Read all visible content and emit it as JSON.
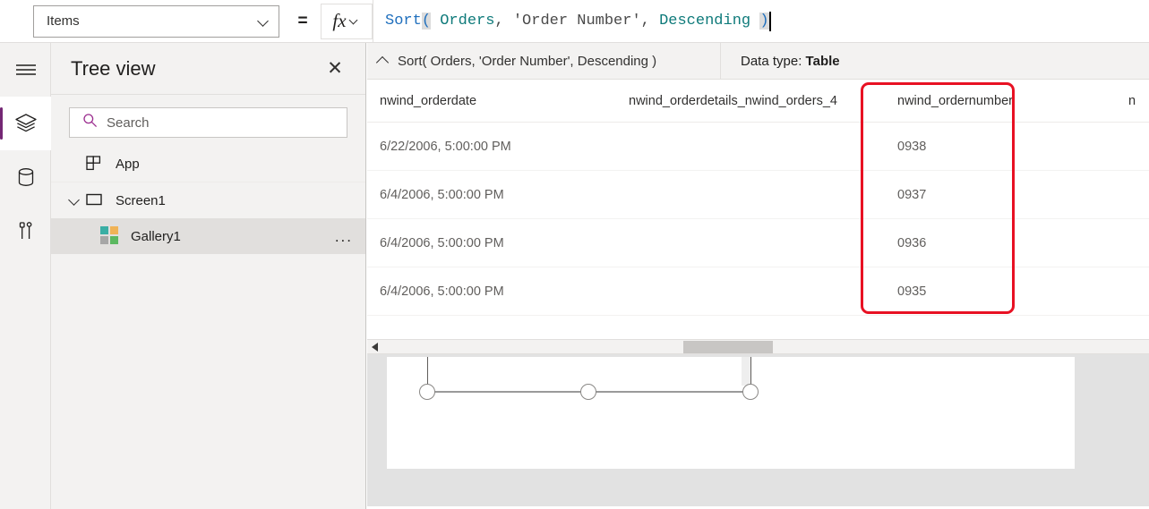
{
  "formula_bar": {
    "property_selector": {
      "value": "Items",
      "chevron_icon": "chevron-down-icon"
    },
    "equals_sign": "=",
    "fx_button": {
      "glyph": "fx",
      "icon": "function-icon",
      "chevron_icon": "chevron-down-icon"
    },
    "formula_tokens": [
      {
        "text": "Sort",
        "type": "function"
      },
      {
        "text": "(",
        "type": "paren"
      },
      {
        "text": " ",
        "type": "plain"
      },
      {
        "text": "Orders",
        "type": "identifier"
      },
      {
        "text": ", ",
        "type": "plain"
      },
      {
        "text": "'Order Number'",
        "type": "string"
      },
      {
        "text": ", ",
        "type": "plain"
      },
      {
        "text": "Descending",
        "type": "identifier"
      },
      {
        "text": " ",
        "type": "plain"
      },
      {
        "text": ")",
        "type": "paren"
      }
    ],
    "formula_text": "Sort( Orders, 'Order Number', Descending )"
  },
  "rail": {
    "items": [
      {
        "name": "hamburger-menu-icon",
        "label": "Menu",
        "active": false
      },
      {
        "name": "tree-view-layers-icon",
        "label": "Tree view",
        "active": true
      },
      {
        "name": "data-sources-icon",
        "label": "Data",
        "active": false
      },
      {
        "name": "insert-tools-icon",
        "label": "Insert",
        "active": false
      }
    ]
  },
  "tree_view": {
    "title": "Tree view",
    "close_icon": "close-icon",
    "search": {
      "placeholder": "Search",
      "value": "",
      "icon": "search-icon"
    },
    "items": [
      {
        "label": "App",
        "icon": "app-grid-icon",
        "level": 1,
        "selected": false,
        "expander": false,
        "overflow": false
      },
      {
        "label": "Screen1",
        "icon": "screen-rect-icon",
        "level": 1,
        "selected": false,
        "expander": true,
        "overflow": false
      },
      {
        "label": "Gallery1",
        "icon": "gallery-icon",
        "level": 2,
        "selected": true,
        "expander": false,
        "overflow": true,
        "overflow_label": "..."
      }
    ]
  },
  "result_summary": {
    "collapse_icon": "chevron-up-icon",
    "formula_text": "Sort( Orders, 'Order Number', Descending )",
    "data_type_label": "Data type:",
    "data_type_value": "Table"
  },
  "result_table": {
    "columns": [
      "nwind_orderdate",
      "nwind_orderdetails_nwind_orders_4",
      "nwind_ordernumber",
      "n"
    ],
    "rows": [
      [
        "6/22/2006, 5:00:00 PM",
        "",
        "0938",
        ""
      ],
      [
        "6/4/2006, 5:00:00 PM",
        "",
        "0937",
        ""
      ],
      [
        "6/4/2006, 5:00:00 PM",
        "",
        "0936",
        ""
      ],
      [
        "6/4/2006, 5:00:00 PM",
        "",
        "0935",
        ""
      ]
    ],
    "highlight": {
      "column": "nwind_ordernumber",
      "color": "#e81123"
    }
  },
  "scrollbar": {
    "left_arrow_icon": "scroll-left-arrow-icon",
    "orientation": "horizontal"
  },
  "canvas": {
    "selected_control": "Gallery1",
    "handles": [
      "resize-handle-left",
      "resize-handle-center",
      "resize-handle-right"
    ]
  },
  "colors": {
    "accent": "#742774",
    "highlight_red": "#e81123",
    "chrome_gray": "#f3f2f1",
    "selected_row": "#e1dfdd"
  }
}
